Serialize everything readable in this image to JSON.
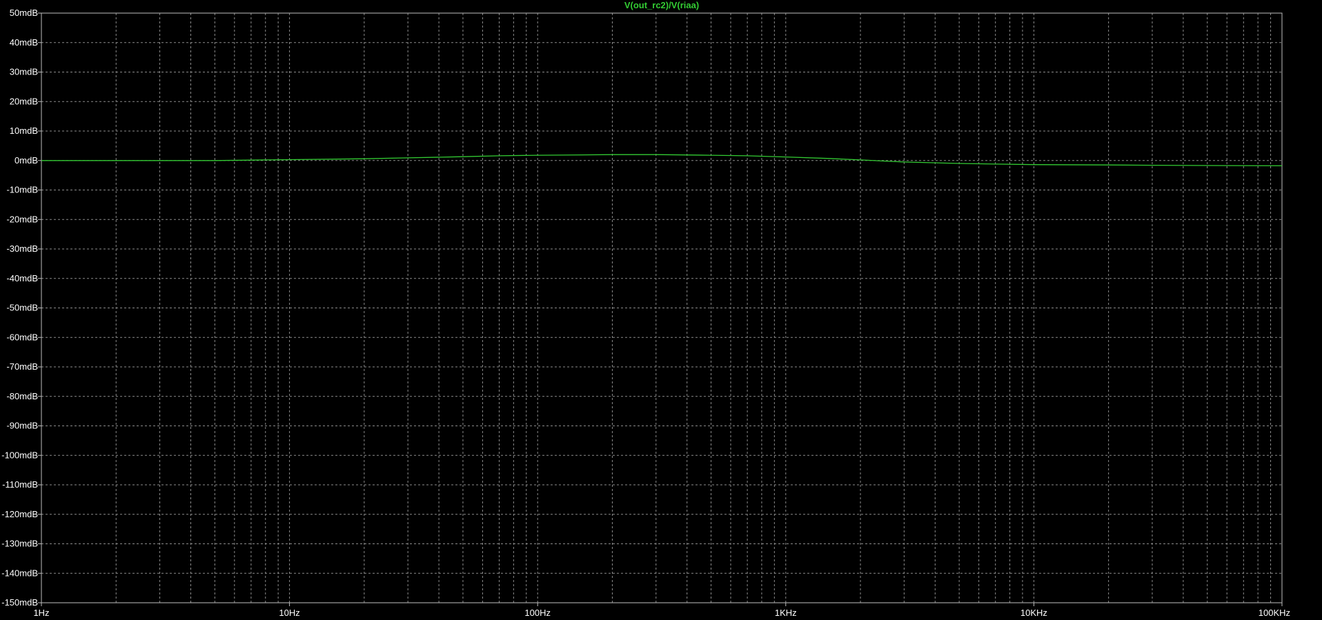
{
  "colors": {
    "background": "#000000",
    "axis": "#bfbfbf",
    "grid": "#8c8c8c",
    "text": "#ffffff",
    "trace": "#33cc33"
  },
  "chart_data": {
    "type": "line",
    "title": "",
    "xlabel": "",
    "ylabel": "",
    "x_scale": "log",
    "grid": true,
    "xlim": [
      1,
      100000
    ],
    "ylim": [
      -150,
      50
    ],
    "x_ticks": [
      {
        "value": 1,
        "label": "1Hz"
      },
      {
        "value": 10,
        "label": "10Hz"
      },
      {
        "value": 100,
        "label": "100Hz"
      },
      {
        "value": 1000,
        "label": "1KHz"
      },
      {
        "value": 10000,
        "label": "10KHz"
      },
      {
        "value": 100000,
        "label": "100KHz"
      }
    ],
    "y_ticks": [
      {
        "value": 50,
        "label": "50mdB"
      },
      {
        "value": 40,
        "label": "40mdB"
      },
      {
        "value": 30,
        "label": "30mdB"
      },
      {
        "value": 20,
        "label": "20mdB"
      },
      {
        "value": 10,
        "label": "10mdB"
      },
      {
        "value": 0,
        "label": "0mdB"
      },
      {
        "value": -10,
        "label": "-10mdB"
      },
      {
        "value": -20,
        "label": "-20mdB"
      },
      {
        "value": -30,
        "label": "-30mdB"
      },
      {
        "value": -40,
        "label": "-40mdB"
      },
      {
        "value": -50,
        "label": "-50mdB"
      },
      {
        "value": -60,
        "label": "-60mdB"
      },
      {
        "value": -70,
        "label": "-70mdB"
      },
      {
        "value": -80,
        "label": "-80mdB"
      },
      {
        "value": -90,
        "label": "-90mdB"
      },
      {
        "value": -100,
        "label": "-100mdB"
      },
      {
        "value": -110,
        "label": "-110mdB"
      },
      {
        "value": -120,
        "label": "-120mdB"
      },
      {
        "value": -130,
        "label": "-130mdB"
      },
      {
        "value": -140,
        "label": "-140mdB"
      },
      {
        "value": -150,
        "label": "-150mdB"
      }
    ],
    "series": [
      {
        "name": "V(out_rc2)/V(riaa)",
        "color": "#33cc33",
        "x": [
          1,
          2,
          5,
          8,
          10,
          20,
          30,
          50,
          70,
          100,
          150,
          200,
          300,
          500,
          700,
          1000,
          1500,
          2000,
          3000,
          5000,
          7000,
          10000,
          20000,
          30000,
          50000,
          100000
        ],
        "y": [
          0,
          0,
          0,
          0.2,
          0.3,
          0.6,
          0.9,
          1.3,
          1.6,
          1.8,
          1.9,
          2.0,
          2.0,
          1.8,
          1.6,
          1.2,
          0.7,
          0.2,
          -0.5,
          -1.0,
          -1.2,
          -1.4,
          -1.5,
          -1.6,
          -1.7,
          -1.8
        ]
      }
    ]
  }
}
